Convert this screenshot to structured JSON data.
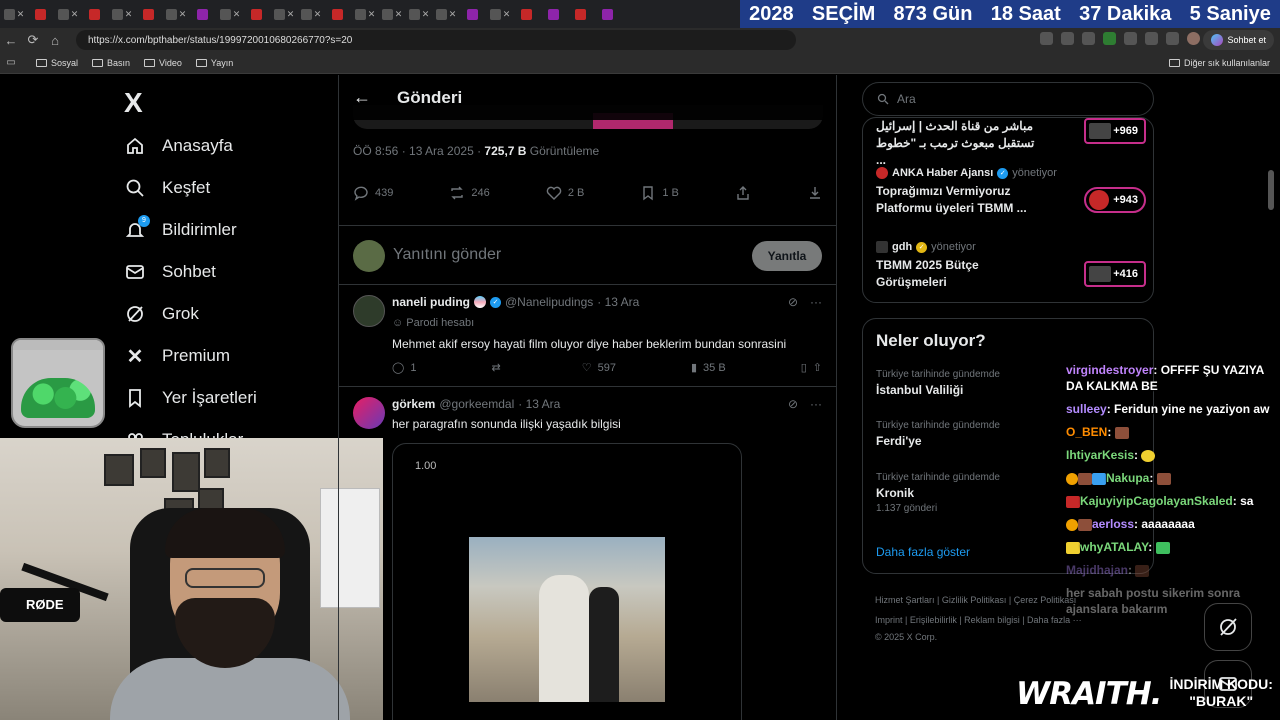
{
  "browser": {
    "tab_count_label": "X",
    "url": "https://x.com/bpthaber/status/1999720010680266770?s=20",
    "chat_button_label": "Sohbet et",
    "bookmarks": [
      "Sosyal",
      "Basın",
      "Video",
      "Yayın"
    ],
    "bookmarks_other": "Diğer sık kullanılanlar"
  },
  "countdown": {
    "year_label": "2028",
    "event_label": "SEÇİM",
    "days": "873 Gün",
    "hours": "18 Saat",
    "minutes": "37 Dakika",
    "seconds": "5 Saniye"
  },
  "sidebar": {
    "logo": "X",
    "notifications_badge": "9",
    "items": [
      {
        "label": "Anasayfa",
        "icon": "home-icon"
      },
      {
        "label": "Keşfet",
        "icon": "search-icon"
      },
      {
        "label": "Bildirimler",
        "icon": "bell-icon"
      },
      {
        "label": "Sohbet",
        "icon": "mail-icon"
      },
      {
        "label": "Grok",
        "icon": "grok-icon"
      },
      {
        "label": "Premium",
        "icon": "x-icon"
      },
      {
        "label": "Yer İşaretleri",
        "icon": "bookmark-icon"
      },
      {
        "label": "Topluluklar",
        "icon": "people-icon"
      }
    ]
  },
  "webcam": {
    "mic_brand": "RØDE"
  },
  "post": {
    "header_title": "Gönderi",
    "time": "ÖÖ 8:56 · 13 Ara 2025 · ",
    "views_value": "725,7 B",
    "views_label": " Görüntüleme",
    "actions": {
      "replies": "439",
      "reposts": "246",
      "likes": "2 B",
      "bookmarks": "1 B"
    },
    "reply_placeholder": "Yanıtını gönder",
    "reply_button": "Yanıtla"
  },
  "replies": [
    {
      "name": "naneli puding",
      "handle": "@Nanelipudings",
      "date": "· 13 Ara",
      "tag": "Parodi hesabı",
      "text": "Mehmet akif ersoy hayati film oluyor diye haber beklerim bundan sonrasini",
      "stats": {
        "replies": "1",
        "reposts": "",
        "likes": "597",
        "views": "35 B"
      }
    },
    {
      "name": "görkem",
      "handle": "@gorkeemdal",
      "date": "· 13 Ara",
      "text": "her paragrafın sonunda ilişki yaşadık bilgisi",
      "video_speed": "1.00"
    }
  ],
  "right": {
    "search_placeholder": "Ara",
    "live": [
      {
        "source": "",
        "role": "",
        "title": "مباشر من قناة الحدث | إسرائيل تستقبل مبعوث ترمب بـ \"خطوط ...",
        "count": "+969"
      },
      {
        "source": "ANKA Haber Ajansı",
        "role": "yönetiyor",
        "title": "Toprağımızı Vermiyoruz Platformu üyeleri TBMM ...",
        "count": "+943"
      },
      {
        "source": "gdh",
        "role": "yönetiyor",
        "title": "TBMM 2025 Bütçe Görüşmeleri",
        "count": "+416"
      }
    ],
    "trends_title": "Neler oluyor?",
    "trends": [
      {
        "context": "Türkiye tarihinde gündemde",
        "title": "İstanbul Valiliği",
        "count": ""
      },
      {
        "context": "Türkiye tarihinde gündemde",
        "title": "Ferdi'ye",
        "count": ""
      },
      {
        "context": "Türkiye tarihinde gündemde",
        "title": "Kronik",
        "count": "1.137 gönderi"
      }
    ],
    "show_more": "Daha fazla göster",
    "footer_line1": "Hizmet Şartları  |  Gizlilik Politikası  |  Çerez Politikası",
    "footer_line2": "Imprint  |  Erişilebilirlik  |  Reklam bilgisi  |  Daha fazla ···",
    "footer_line3": "© 2025 X Corp."
  },
  "chat": [
    {
      "user": "virgindestroyer",
      "color": "#c084fc",
      "text": "OFFFF ŞU YAZIYA DA KALKMA BE"
    },
    {
      "user": "sulleey",
      "color": "#b48cff",
      "text": "Feridun yine ne yaziyon aw"
    },
    {
      "user": "O_BEN",
      "color": "#ff8c00",
      "text": ""
    },
    {
      "user": "IhtiyarKesis",
      "color": "#7bd87b",
      "text": ""
    },
    {
      "user": "Nakupa",
      "color": "#7bd87b",
      "text": ""
    },
    {
      "user": "KajuyiyipCagolayanSkaled",
      "color": "#7bd87b",
      "text": "sa"
    },
    {
      "user": "aerloss",
      "color": "#b48cff",
      "text": "aaaaaaaa"
    },
    {
      "user": "whyATALAY",
      "color": "#7bd87b",
      "text": ""
    },
    {
      "user": "Majidhajan",
      "color": "#b48cff",
      "text": ""
    },
    {
      "user": "",
      "color": "#ff5a5a",
      "text": "her sabah postu sikerim sonra ajanslara bakarım"
    }
  ],
  "sponsor": {
    "brand": "WRAITH.",
    "promo_line1": "İNDİRİM KODU:",
    "promo_line2": "\"BURAK\""
  }
}
